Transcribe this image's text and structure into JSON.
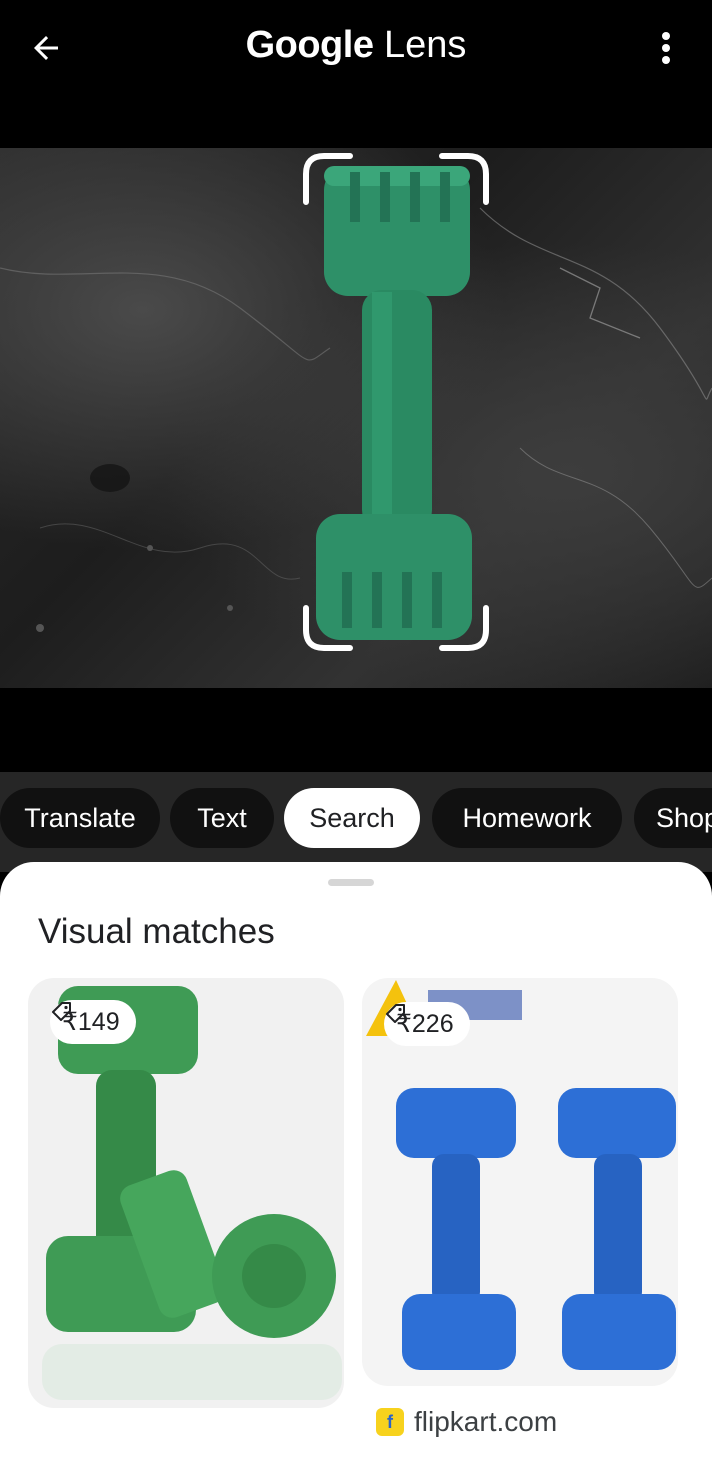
{
  "header": {
    "title_brand": "Google",
    "title_product": "Lens",
    "back_icon": "arrow-left-icon",
    "menu_icon": "more-vert-icon"
  },
  "chips": [
    {
      "label": "Translate",
      "active": false
    },
    {
      "label": "Text",
      "active": false
    },
    {
      "label": "Search",
      "active": true
    },
    {
      "label": "Homework",
      "active": false
    },
    {
      "label": "Shop",
      "active": false
    }
  ],
  "sheet": {
    "title": "Visual matches"
  },
  "results": [
    {
      "price": "₹149",
      "color": "#3f9b55",
      "site": ""
    },
    {
      "price": "₹226",
      "color": "#2d6fd6",
      "site": "flipkart.com"
    }
  ],
  "colors": {
    "dumbbell_green": "#2e9068",
    "product_green": "#3f9b55",
    "product_blue": "#2d6fd6"
  }
}
